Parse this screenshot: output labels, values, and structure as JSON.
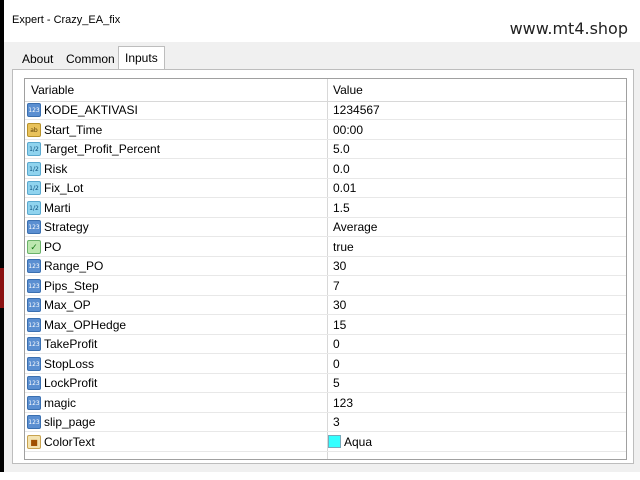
{
  "window": {
    "title": "Expert - Crazy_EA_fix",
    "watermark": "www.mt4.shop"
  },
  "tabs": [
    {
      "label": "About"
    },
    {
      "label": "Common"
    },
    {
      "label": "Inputs"
    }
  ],
  "active_tab": "Inputs",
  "table": {
    "headers": {
      "variable": "Variable",
      "value": "Value"
    },
    "rows": [
      {
        "icon": "int-icon",
        "name": "KODE_AKTIVASI",
        "value": "1234567"
      },
      {
        "icon": "string-icon",
        "name": "Start_Time",
        "value": "00:00"
      },
      {
        "icon": "double-icon",
        "name": "Target_Profit_Percent",
        "value": "5.0"
      },
      {
        "icon": "double-icon",
        "name": "Risk",
        "value": "0.0"
      },
      {
        "icon": "double-icon",
        "name": "Fix_Lot",
        "value": "0.01"
      },
      {
        "icon": "double-icon",
        "name": "Marti",
        "value": "1.5"
      },
      {
        "icon": "int-icon",
        "name": "Strategy",
        "value": "Average"
      },
      {
        "icon": "bool-icon",
        "name": "PO",
        "value": "true"
      },
      {
        "icon": "int-icon",
        "name": "Range_PO",
        "value": "30"
      },
      {
        "icon": "int-icon",
        "name": "Pips_Step",
        "value": "7"
      },
      {
        "icon": "int-icon",
        "name": "Max_OP",
        "value": "30"
      },
      {
        "icon": "int-icon",
        "name": "Max_OPHedge",
        "value": "15"
      },
      {
        "icon": "int-icon",
        "name": "TakeProfit",
        "value": "0"
      },
      {
        "icon": "int-icon",
        "name": "StopLoss",
        "value": "0"
      },
      {
        "icon": "int-icon",
        "name": "LockProfit",
        "value": "5"
      },
      {
        "icon": "int-icon",
        "name": "magic",
        "value": "123"
      },
      {
        "icon": "int-icon",
        "name": "slip_page",
        "value": "3"
      },
      {
        "icon": "color-icon",
        "name": "ColorText",
        "value": "Aqua",
        "swatch_color": "#33ffff"
      }
    ]
  }
}
